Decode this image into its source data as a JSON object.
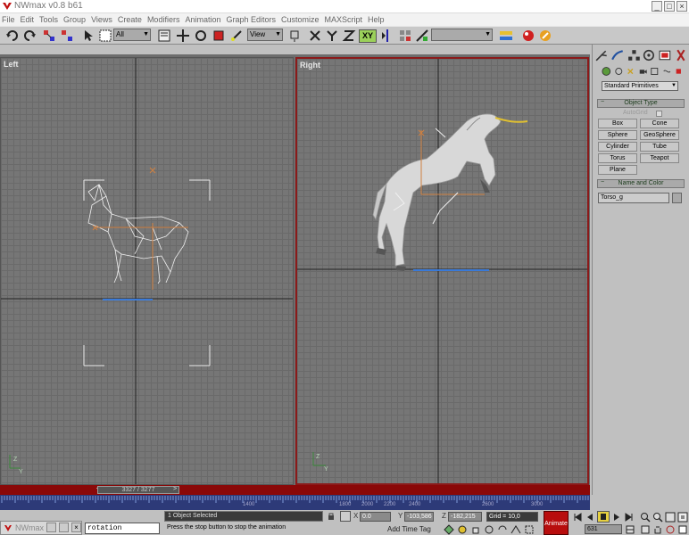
{
  "window": {
    "title": "NWmax v0.8 b61"
  },
  "menu": [
    "File",
    "Edit",
    "Tools",
    "Group",
    "Views",
    "Create",
    "Modifiers",
    "Animation",
    "Graph Editors",
    "Customize",
    "MAXScript",
    "Help"
  ],
  "toolbar": {
    "selection_filter": "All",
    "coord_system": "View",
    "axis_constraint": "XY",
    "named_selection": ""
  },
  "viewports": {
    "left": {
      "label": "Left"
    },
    "right": {
      "label": "Right"
    }
  },
  "command_panel": {
    "category": "Standard Primitives",
    "object_type_header": "Object Type",
    "autogrid": "AutoGrid",
    "buttons": [
      "Box",
      "Cone",
      "Sphere",
      "GeoSphere",
      "Cylinder",
      "Tube",
      "Torus",
      "Teapot",
      "Plane"
    ],
    "name_color_header": "Name and Color",
    "object_name": "Torso_g"
  },
  "timeline": {
    "slider_label": "3327 / 3277",
    "ticks": [
      "1400",
      "1800",
      "2000",
      "2200",
      "2400",
      "2600",
      "3000"
    ]
  },
  "status": {
    "taskbar_label": "NWmax",
    "command_input": "rotation",
    "selection": "1 Object Selected",
    "prompt": "Press the stop button to stop the animation",
    "x_label": "X",
    "x_value": "0.0",
    "y_label": "Y",
    "y_value": "-103,586",
    "z_label": "Z",
    "z_value": "-182,215",
    "grid": "Grid = 10,0",
    "add_time_tag": "Add Time Tag",
    "animate": "Animate",
    "frame": "631"
  },
  "colors": {
    "active_viewport": "#8b1a1a",
    "animate": "#b80d0d",
    "trackbar": "#2d3a78",
    "xy_button": "#9bd05a"
  }
}
